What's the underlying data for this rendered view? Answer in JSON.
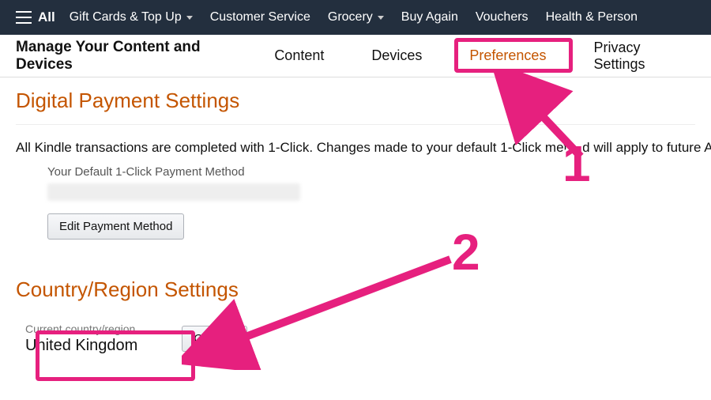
{
  "topnav": {
    "all": "All",
    "items": [
      "Gift Cards & Top Up",
      "Customer Service",
      "Grocery",
      "Buy Again",
      "Vouchers",
      "Health & Person"
    ]
  },
  "subnav": {
    "title": "Manage Your Content and Devices",
    "tabs": [
      "Content",
      "Devices",
      "Preferences",
      "Privacy Settings"
    ],
    "active_index": 2
  },
  "payment": {
    "heading": "Digital Payment Settings",
    "blurb": "All Kindle transactions are completed with 1-Click. Changes made to your default 1-Click method will apply to future Am",
    "default_label": "Your Default 1-Click Payment Method",
    "edit_button": "Edit Payment Method"
  },
  "region": {
    "heading": "Country/Region Settings",
    "label": "Current country/region",
    "value": "United Kingdom",
    "change_button": "Change"
  },
  "annotations": {
    "step1": "1",
    "step2": "2"
  }
}
